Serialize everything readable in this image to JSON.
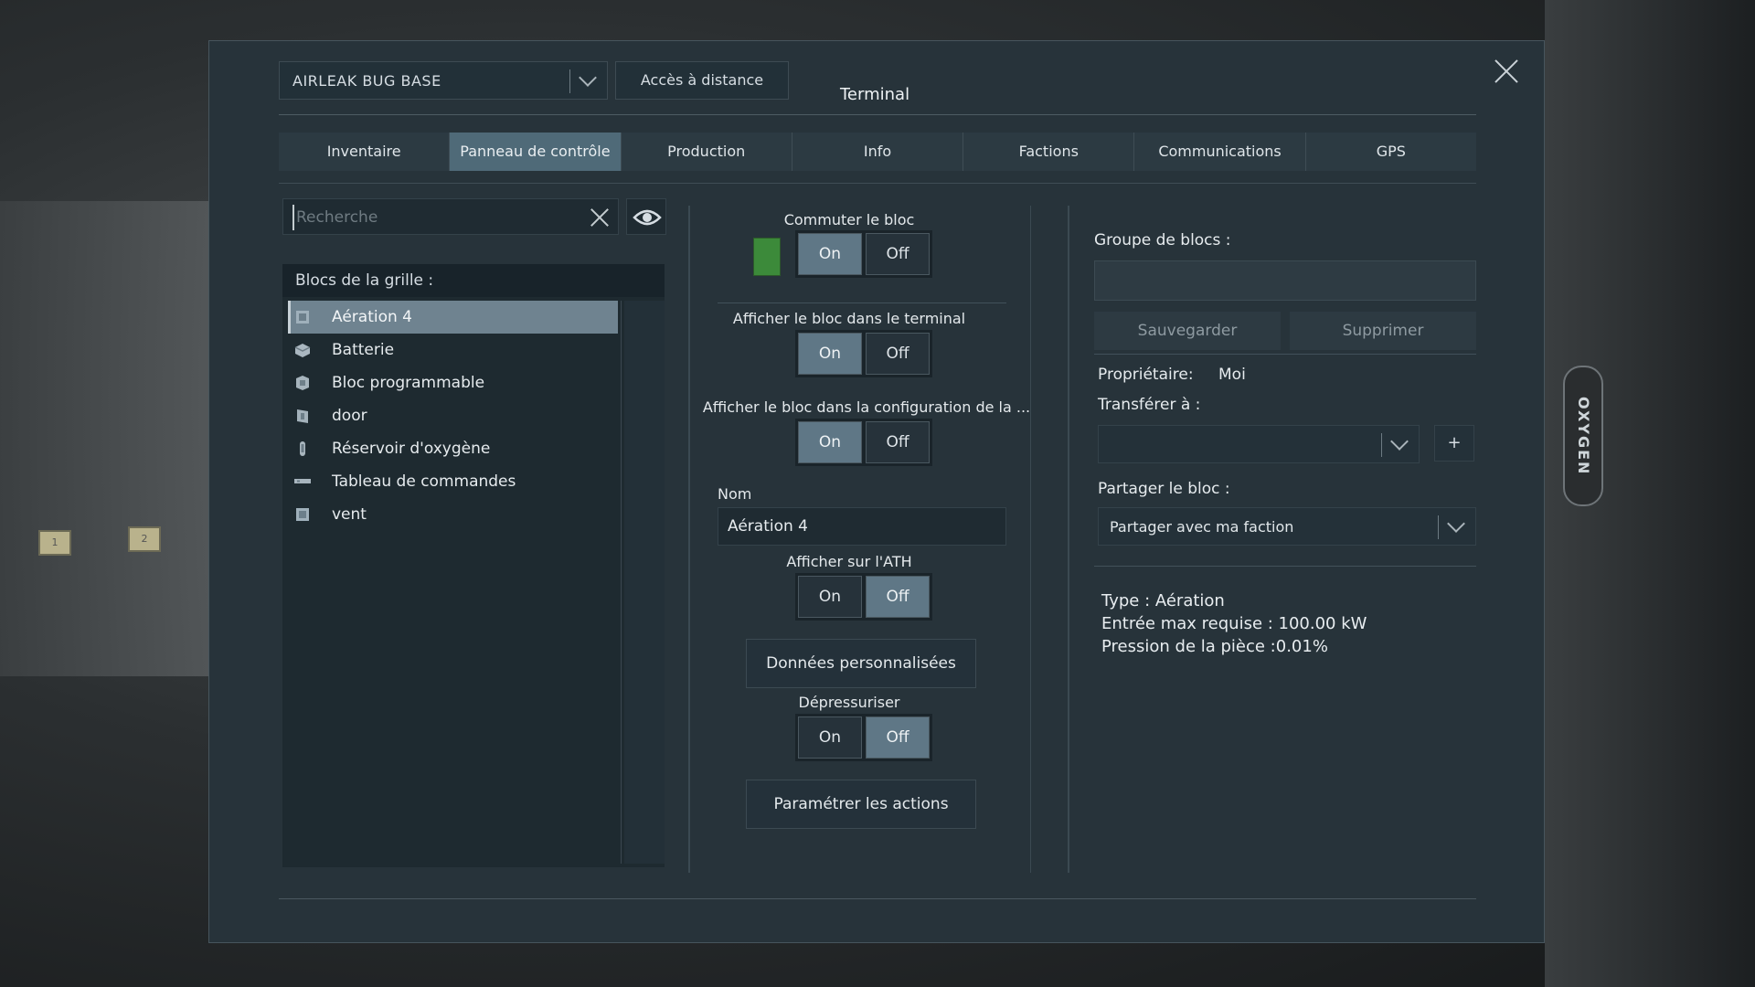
{
  "background": {
    "tag1": "1",
    "tag2": "2",
    "oxygen_label": "OXYGEN"
  },
  "terminal": {
    "grid_selector": "AIRLEAK BUG BASE",
    "remote_access_label": "Accès à distance",
    "title": "Terminal",
    "tabs": [
      {
        "label": "Inventaire"
      },
      {
        "label": "Panneau de contrôle",
        "active": true
      },
      {
        "label": "Production"
      },
      {
        "label": "Info"
      },
      {
        "label": "Factions"
      },
      {
        "label": "Communications"
      },
      {
        "label": "GPS"
      }
    ]
  },
  "left": {
    "search_placeholder": "Recherche",
    "list_title": "Blocs de la grille :",
    "blocks": [
      {
        "label": "Aération 4",
        "icon": "vent-block-icon",
        "selected": true
      },
      {
        "label": "Batterie",
        "icon": "battery-block-icon"
      },
      {
        "label": "Bloc programmable",
        "icon": "programmable-block-icon"
      },
      {
        "label": "door",
        "icon": "door-block-icon"
      },
      {
        "label": "Réservoir d'oxygène",
        "icon": "oxygen-tank-icon"
      },
      {
        "label": "Tableau de commandes",
        "icon": "control-panel-icon"
      },
      {
        "label": "vent",
        "icon": "vent-block-icon"
      }
    ]
  },
  "middle": {
    "toggle_block": {
      "label": "Commuter le bloc",
      "on": "On",
      "off": "Off",
      "state": "on"
    },
    "show_in_terminal": {
      "label": "Afficher le bloc dans le terminal",
      "on": "On",
      "off": "Off",
      "state": "on"
    },
    "show_in_config": {
      "label": "Afficher le bloc dans la configuration de la ...",
      "on": "On",
      "off": "Off",
      "state": "on"
    },
    "name_label": "Nom",
    "name_value": "Aération 4",
    "show_on_hud": {
      "label": "Afficher sur l'ATH",
      "on": "On",
      "off": "Off",
      "state": "off"
    },
    "custom_data_label": "Données personnalisées",
    "depressurize": {
      "label": "Dépressuriser",
      "on": "On",
      "off": "Off",
      "state": "off"
    },
    "setup_actions_label": "Paramétrer les actions"
  },
  "right": {
    "group_label": "Groupe de blocs :",
    "save_label": "Sauvegarder",
    "delete_label": "Supprimer",
    "owner_label": "Propriétaire:",
    "owner_value": "Moi",
    "transfer_label": "Transférer à :",
    "transfer_value": "",
    "plus_label": "+",
    "share_label": "Partager le bloc :",
    "share_value": "Partager avec ma faction",
    "info": {
      "type": "Type : Aération",
      "max_input": "Entrée max requise : 100.00 kW",
      "room_pressure": "Pression de la pièce :0.01%"
    }
  },
  "colors": {
    "panel_bg": "#27333a",
    "tab_active": "#4f6a78",
    "toggle_active": "#5f7786",
    "status_led": "#3c8a3a"
  }
}
